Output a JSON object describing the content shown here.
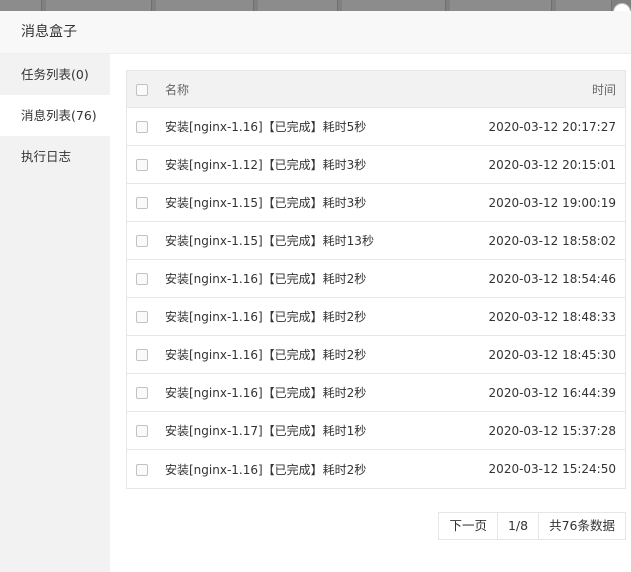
{
  "dialog": {
    "title": "消息盒子"
  },
  "sidebar": {
    "items": [
      {
        "label": "任务列表(0)"
      },
      {
        "label": "消息列表(76)"
      },
      {
        "label": "执行日志"
      }
    ]
  },
  "table": {
    "headers": {
      "name": "名称",
      "time": "时间"
    },
    "rows": [
      {
        "name": "安装[nginx-1.16]【已完成】耗时5秒",
        "time": "2020-03-12 20:17:27"
      },
      {
        "name": "安装[nginx-1.12]【已完成】耗时3秒",
        "time": "2020-03-12 20:15:01"
      },
      {
        "name": "安装[nginx-1.15]【已完成】耗时3秒",
        "time": "2020-03-12 19:00:19"
      },
      {
        "name": "安装[nginx-1.15]【已完成】耗时13秒",
        "time": "2020-03-12 18:58:02"
      },
      {
        "name": "安装[nginx-1.16]【已完成】耗时2秒",
        "time": "2020-03-12 18:54:46"
      },
      {
        "name": "安装[nginx-1.16]【已完成】耗时2秒",
        "time": "2020-03-12 18:48:33"
      },
      {
        "name": "安装[nginx-1.16]【已完成】耗时2秒",
        "time": "2020-03-12 18:45:30"
      },
      {
        "name": "安装[nginx-1.16]【已完成】耗时2秒",
        "time": "2020-03-12 16:44:39"
      },
      {
        "name": "安装[nginx-1.17]【已完成】耗时1秒",
        "time": "2020-03-12 15:37:28"
      },
      {
        "name": "安装[nginx-1.16]【已完成】耗时2秒",
        "time": "2020-03-12 15:24:50"
      }
    ]
  },
  "pager": {
    "next_label": "下一页",
    "page": "1/8",
    "total": "共76条数据"
  }
}
